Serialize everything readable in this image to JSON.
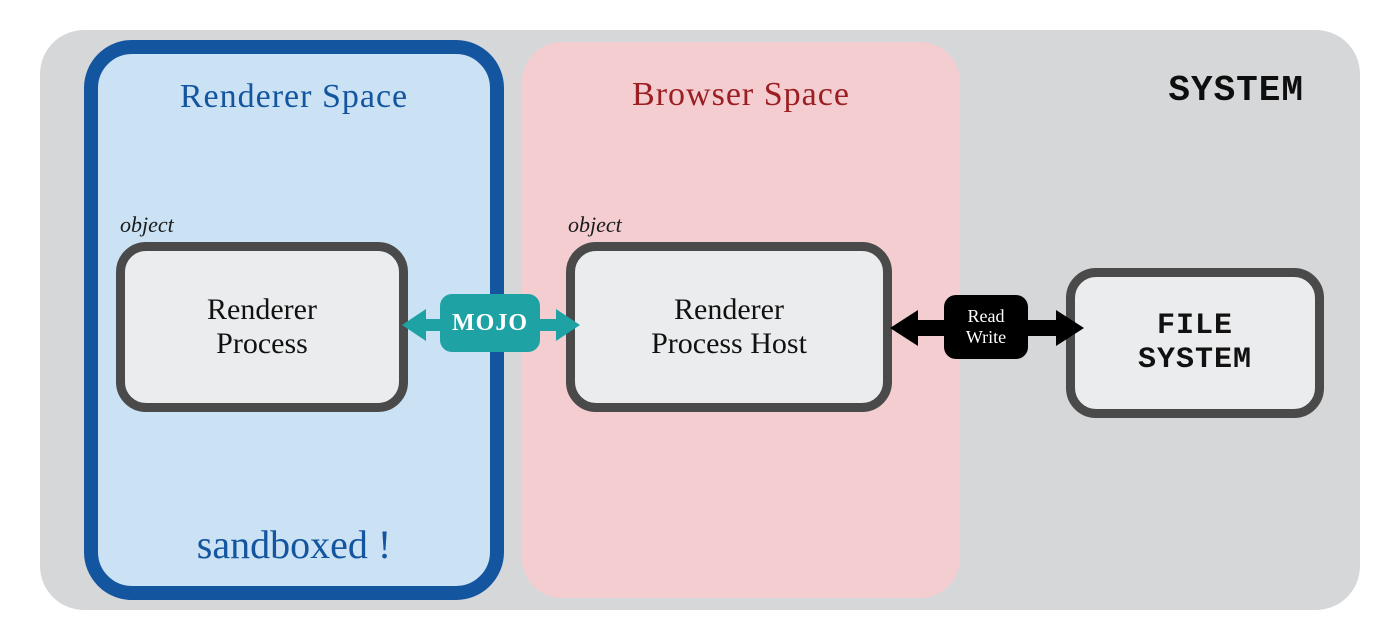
{
  "system": {
    "label": "SYSTEM"
  },
  "renderer_space": {
    "title": "Renderer Space",
    "sandboxed": "sandboxed !",
    "object_label": "object",
    "node": "Renderer\nProcess"
  },
  "browser_space": {
    "title": "Browser Space",
    "object_label": "object",
    "node": "Renderer\nProcess Host"
  },
  "fs_node": "FILE\nSYSTEM",
  "connectors": {
    "mojo": "MOJO",
    "rw_line1": "Read",
    "rw_line2": "Write"
  },
  "colors": {
    "system_bg": "#d6d7d8",
    "renderer_bg": "#cae2f3",
    "renderer_border": "#1455a0",
    "browser_bg": "#f4cdd1",
    "browser_title": "#9b1e23",
    "node_border": "#4a4a4a",
    "teal": "#1fa2a4",
    "black": "#000000"
  }
}
